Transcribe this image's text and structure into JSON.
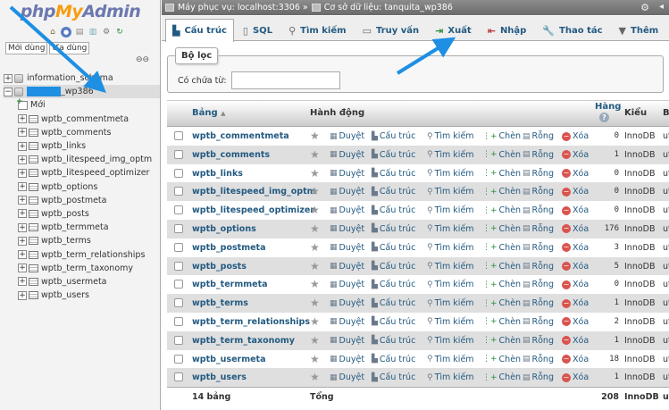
{
  "logo": {
    "php": "php",
    "my": "My",
    "admin": "Admin"
  },
  "nav_icons": [
    "home-icon",
    "exit-icon",
    "doc-icon",
    "doc2-icon",
    "gear-icon",
    "refresh-icon"
  ],
  "left_tabs": [
    "Mới dùng",
    "Ưa dùng"
  ],
  "tree": {
    "db1": "information_schema",
    "db2_suffix": "_wp386",
    "new_label": "Mới",
    "tables": [
      "wptb_commentmeta",
      "wptb_comments",
      "wptb_links",
      "wptb_litespeed_img_optm",
      "wptb_litespeed_optimizer",
      "wptb_options",
      "wptb_postmeta",
      "wptb_posts",
      "wptb_termmeta",
      "wptb_terms",
      "wptb_term_relationships",
      "wptb_term_taxonomy",
      "wptb_usermeta",
      "wptb_users"
    ]
  },
  "breadcrumb": {
    "server": "Máy phục vụ: localhost:3306 »",
    "database": "Cơ sở dữ liệu: tanquita_wp386"
  },
  "tabs": [
    {
      "label": "Cấu trúc",
      "icon": "structure-icon"
    },
    {
      "label": "SQL",
      "icon": "sql-icon"
    },
    {
      "label": "Tìm kiếm",
      "icon": "search-icon"
    },
    {
      "label": "Truy vấn",
      "icon": "query-icon"
    },
    {
      "label": "Xuất",
      "icon": "export-icon"
    },
    {
      "label": "Nhập",
      "icon": "import-icon"
    },
    {
      "label": "Thao tác",
      "icon": "wrench-icon"
    },
    {
      "label": "Thêm",
      "icon": "chevron-down-icon"
    }
  ],
  "filter": {
    "legend": "Bộ lọc",
    "label": "Có chứa từ:",
    "value": ""
  },
  "table_header": {
    "name": "Bảng",
    "sort": "▲",
    "action": "Hành động",
    "rows": "Hàng",
    "type": "Kiểu",
    "collation": "B"
  },
  "actions": {
    "browse": "Duyệt",
    "structure": "Cấu trúc",
    "search": "Tìm kiếm",
    "insert": "Chèn",
    "empty": "Rỗng",
    "drop": "Xóa"
  },
  "rows": [
    {
      "name": "wptb_commentmeta",
      "count": "0",
      "engine": "InnoDB",
      "collation": "ut"
    },
    {
      "name": "wptb_comments",
      "count": "1",
      "engine": "InnoDB",
      "collation": "ut"
    },
    {
      "name": "wptb_links",
      "count": "0",
      "engine": "InnoDB",
      "collation": "ut"
    },
    {
      "name": "wptb_litespeed_img_optm",
      "count": "0",
      "engine": "InnoDB",
      "collation": "ut"
    },
    {
      "name": "wptb_litespeed_optimizer",
      "count": "0",
      "engine": "InnoDB",
      "collation": "ut"
    },
    {
      "name": "wptb_options",
      "count": "176",
      "engine": "InnoDB",
      "collation": "ut"
    },
    {
      "name": "wptb_postmeta",
      "count": "3",
      "engine": "InnoDB",
      "collation": "ut"
    },
    {
      "name": "wptb_posts",
      "count": "5",
      "engine": "InnoDB",
      "collation": "ut"
    },
    {
      "name": "wptb_termmeta",
      "count": "0",
      "engine": "InnoDB",
      "collation": "ut"
    },
    {
      "name": "wptb_terms",
      "count": "1",
      "engine": "InnoDB",
      "collation": "ut"
    },
    {
      "name": "wptb_term_relationships",
      "count": "2",
      "engine": "InnoDB",
      "collation": "ut"
    },
    {
      "name": "wptb_term_taxonomy",
      "count": "1",
      "engine": "InnoDB",
      "collation": "ut"
    },
    {
      "name": "wptb_usermeta",
      "count": "18",
      "engine": "InnoDB",
      "collation": "ut"
    },
    {
      "name": "wptb_users",
      "count": "1",
      "engine": "InnoDB",
      "collation": "ut"
    }
  ],
  "footer": {
    "tables": "14 bảng",
    "total": "Tổng",
    "count": "208",
    "engine": "InnoDB",
    "collation": "ut"
  },
  "colors": {
    "accent": "#235a81",
    "annotation": "#1e8fe3",
    "logo_blue": "#6c78af",
    "logo_orange": "#f89c0e"
  }
}
